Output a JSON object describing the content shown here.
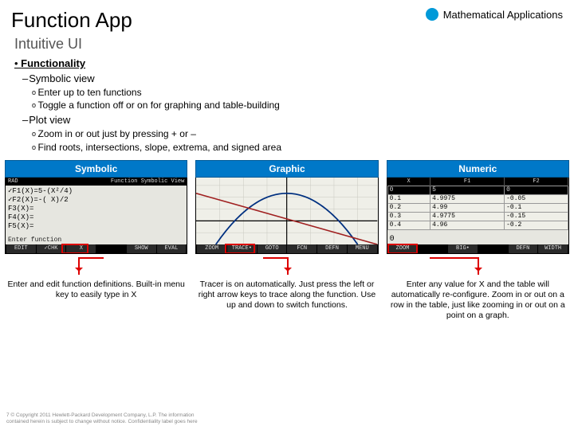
{
  "header": {
    "title": "Function App",
    "brand": "Mathematical Applications",
    "subtitle": "Intuitive UI"
  },
  "outline": {
    "l1": "Functionality",
    "l2a": "Symbolic view",
    "l2a_i": "Enter up to ten functions",
    "l2a_ii": "Toggle a function off or on for graphing and table-building",
    "l2b": "Plot view",
    "l2b_i": "Zoom in or out just by pressing + or –",
    "l2b_ii": "Find roots, intersections, slope, extrema, and signed area"
  },
  "panels": {
    "symbolic": {
      "title": "Symbolic",
      "topLeft": "RAD",
      "topRight": "Function Symbolic View",
      "rows": {
        "r1": "✓F1(X)=5-(X²/4)",
        "r2": "✓F2(X)=-( X)/2",
        "r3": "F3(X)=",
        "r4": "F4(X)=",
        "r5": "F5(X)="
      },
      "hint": "Enter function",
      "menu": {
        "m1": "EDIT",
        "m2": "✓CHK",
        "m3": "X",
        "m4": "",
        "m5": "SHOW",
        "m6": "EVAL"
      }
    },
    "graphic": {
      "title": "Graphic",
      "menu": {
        "m1": "ZOOM",
        "m2": "TRACE•",
        "m3": "GOTO",
        "m4": "FCN",
        "m5": "DEFN",
        "m6": "MENU"
      }
    },
    "numeric": {
      "title": "Numeric",
      "headers": {
        "h1": "X",
        "h2": "F1",
        "h3": "F2"
      },
      "rows": [
        {
          "x": "0",
          "f1": "5",
          "f2": "0"
        },
        {
          "x": "0.1",
          "f1": "4.9975",
          "f2": "-0.05"
        },
        {
          "x": "0.2",
          "f1": "4.99",
          "f2": "-0.1"
        },
        {
          "x": "0.3",
          "f1": "4.9775",
          "f2": "-0.15"
        },
        {
          "x": "0.4",
          "f1": "4.96",
          "f2": "-0.2"
        }
      ],
      "big": "0",
      "menu": {
        "m1": "ZOOM",
        "m2": "",
        "m3": "BIG•",
        "m4": "",
        "m5": "DEFN",
        "m6": "WIDTH"
      }
    }
  },
  "captions": {
    "c1": "Enter and edit function definitions. Built-in menu key to easily type in X",
    "c2": "Tracer is on automatically. Just press the left or right arrow keys to trace along the function. Use up and down to switch functions.",
    "c3": "Enter any value for X and the table will automatically re-configure. Zoom in or out on a row in the table, just like zooming in or out on a point on a graph."
  },
  "footer": {
    "l1": "7 © Copyright 2011 Hewlett-Packard Development Company, L.P. The information",
    "l2": "contained herein is subject to change without notice. Confidentiality label goes here"
  }
}
